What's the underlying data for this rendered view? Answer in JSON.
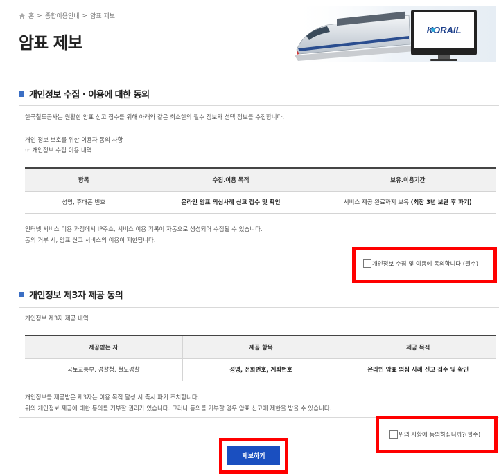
{
  "breadcrumb": {
    "home": "홈",
    "sep1": ">",
    "level1": "종합이용안내",
    "sep2": ">",
    "current": "암표 제보"
  },
  "page_title": "암표 제보",
  "hero": {
    "logo_text": "KORAIL"
  },
  "section1": {
    "title": "개인정보 수집 · 이용에 대한 동의",
    "intro": "한국철도공사는 원활한 암표 신고 접수를 위해 아래와 같은 최소한의 필수 정보와 선택 정보를 수집합니다.",
    "subtitle": "개인 정보 보호를 위한 이용자 동의 사항",
    "sublink": "☞ 개인정보 수집 이용 내역",
    "table": {
      "headers": [
        "항목",
        "수집.이용 목적",
        "보유.이용기간"
      ],
      "row": {
        "item": "성명, 휴대폰 번호",
        "purpose": "온라인 암표 의심사례 신고 접수 및 확인",
        "period_prefix": "서비스 제공 완료까지 보유 ",
        "period_bold": "(최장 3년 보관 후 파기)"
      }
    },
    "note1": "인터넷 서비스 이용 과정에서 IP주소, 서비스 이용 기록이 자동으로 생성되어 수집될 수 있습니다.",
    "note2": "동의 거부 시, 암표 신고 서비스의 이용이 제한됩니다.",
    "agree_label": "개인정보 수집 및 이용에 동의합니다.(필수)"
  },
  "section2": {
    "title": "개인정보 제3자 제공 동의",
    "intro": "개인정보 제3자 제공 내역",
    "table": {
      "headers": [
        "제공받는 자",
        "제공 항목",
        "제공 목적"
      ],
      "row": {
        "recipient": "국토교통부, 경찰청, 철도경찰",
        "items": "성명, 전화번호, 계좌번호",
        "purpose": "온라인 암표 의심 사례 신고 접수 및 확인"
      }
    },
    "note1": "개인정보를 제공받은 제3자는 이용 목적 달성 시 즉시 파기 조치합니다.",
    "note2": "위의 개인정보 제공에 대한 동의를 거부할 권리가 있습니다. 그러나 동의를 거부할 경우 암표 신고에 제한을 받을 수 있습니다.",
    "agree_label": "위의 사항에 동의하십니까?(필수)"
  },
  "submit_label": "제보하기",
  "colors": {
    "accent": "#1a4fc0",
    "highlight": "#ff0000",
    "section_marker": "#3b6fc4"
  }
}
